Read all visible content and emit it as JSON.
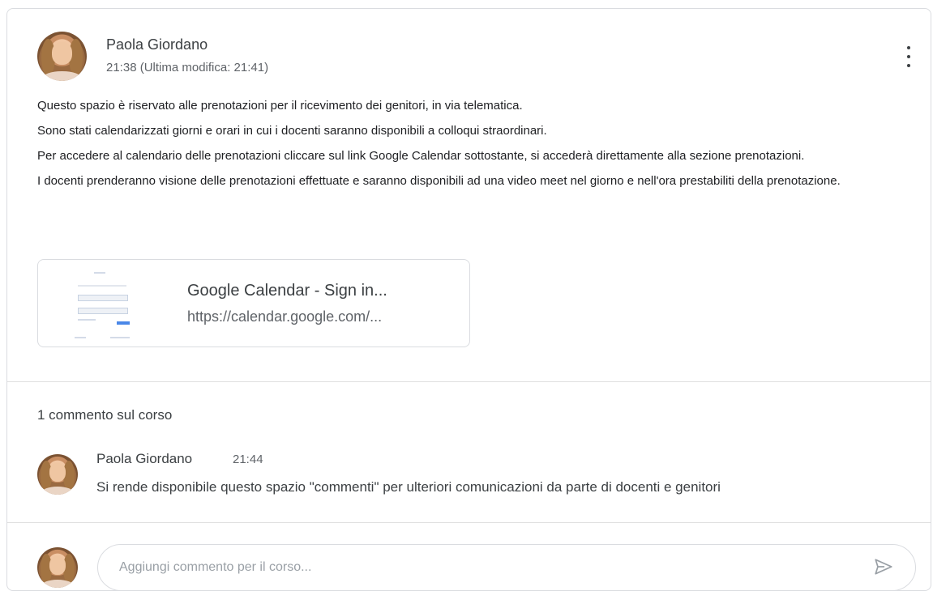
{
  "post": {
    "author": "Paola Giordano",
    "time": "21:38 (Ultima modifica: 21:41)",
    "body": [
      "Questo spazio è riservato alle prenotazioni per il ricevimento dei genitori, in via telematica.",
      "Sono stati calendarizzati giorni e orari in cui i docenti saranno disponibili a colloqui straordinari.",
      "Per accedere al calendario delle prenotazioni cliccare sul link Google Calendar sottostante, si accederà direttamente alla sezione prenotazioni.",
      "I docenti prenderanno visione delle prenotazioni effettuate e saranno disponibili ad una video meet nel giorno e nell'ora prestabiliti della prenotazione."
    ],
    "attachment": {
      "title": "Google Calendar - Sign in...",
      "url": "https://calendar.google.com/..."
    },
    "more_icon": "more-vert-icon"
  },
  "comments": {
    "count_label": "1 commento sul corso",
    "items": [
      {
        "author": "Paola Giordano",
        "time": "21:44",
        "text": "Si rende disponibile questo spazio \"commenti\" per ulteriori comunicazioni da parte di docenti e genitori"
      }
    ],
    "input_placeholder": "Aggiungi commento per il corso...",
    "send_icon": "send-icon"
  }
}
